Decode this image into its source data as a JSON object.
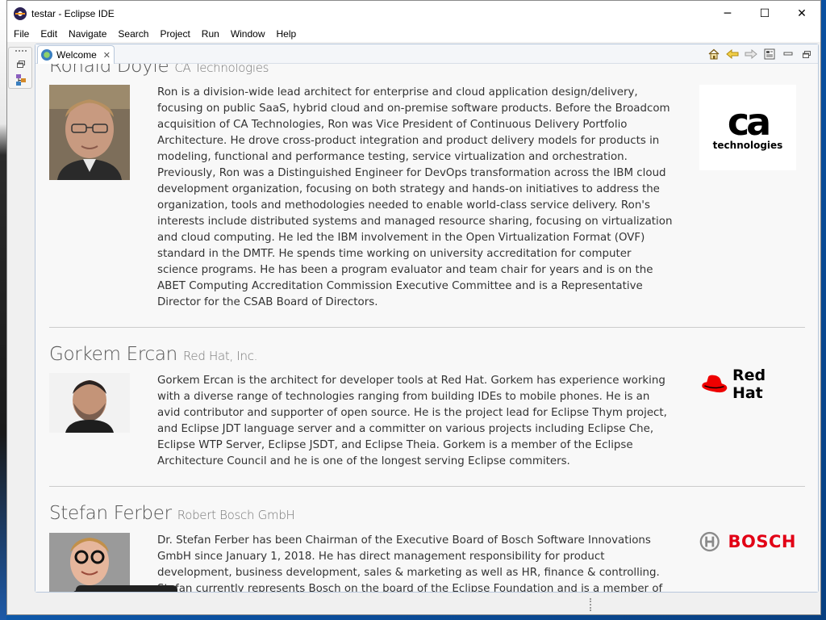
{
  "window": {
    "title": "testar - Eclipse IDE",
    "minimize": "─",
    "maximize": "☐",
    "close": "✕"
  },
  "menu": [
    "File",
    "Edit",
    "Navigate",
    "Search",
    "Project",
    "Run",
    "Window",
    "Help"
  ],
  "view": {
    "tab_label": "Welcome",
    "tab_close": "✕"
  },
  "people": [
    {
      "name": "Ronald Doyle",
      "company": "CA Technologies",
      "bio": "Ron is a division-wide lead architect for enterprise and cloud application design/delivery, focusing on public SaaS, hybrid cloud and on-premise software products. Before the Broadcom acquisition of CA Technologies, Ron was Vice President of Continuous Delivery Portfolio Architecture. He drove cross-product integration and product delivery models for products in modeling, functional and performance testing, service virtualization and orchestration. Previously, Ron was a Distinguished Engineer for DevOps transformation across the IBM cloud development organization, focusing on both strategy and hands-on initiatives to address the organization, tools and methodologies needed to enable world-class service delivery. Ron's interests include distributed systems and managed resource sharing, focusing on virtualization and cloud computing. He led the IBM involvement in the Open Virtualization Format (OVF) standard in the DMTF. He spends time working on university accreditation for computer science programs. He has been a program evaluator and team chair for years and is on the ABET Computing Accreditation Commission Executive Committee and is a Representative Director for the CSAB Board of Directors.",
      "logo_main": "ca",
      "logo_sub": "technologies"
    },
    {
      "name": "Gorkem Ercan",
      "company": "Red Hat, Inc.",
      "bio": "Gorkem Ercan is the architect for developer tools at Red Hat. Gorkem has experience working with a diverse range of technologies ranging from building IDEs to mobile phones. He is an avid contributor and supporter of open source. He is the project lead for Eclipse Thym project, and Eclipse JDT language server and a committer on various projects including Eclipse Che, Eclipse WTP Server, Eclipse JSDT, and Eclipse Theia. Gorkem is a member of the Eclipse Architecture Council and he is one of the longest serving Eclipse commiters.",
      "logo_main": "Red Hat"
    },
    {
      "name": "Stefan Ferber",
      "company": "Robert Bosch GmbH",
      "bio": "Dr. Stefan Ferber has been Chairman of the Executive Board of Bosch Software Innovations GmbH since January 1, 2018. He has direct management responsibility for product development, business development, sales & marketing as well as HR, finance & controlling. Stefan currently represents Bosch on the board of the Eclipse Foundation and is a member of the European Internet of Things",
      "logo_main": "BOSCH"
    }
  ],
  "colors": {
    "ca_black": "#000000",
    "redhat_red": "#ee0000",
    "bosch_red": "#e20015"
  },
  "icons": [
    "home-icon",
    "back-arrow-icon",
    "forward-arrow-icon",
    "print-icon",
    "minimize-view-icon",
    "maximize-view-icon"
  ]
}
